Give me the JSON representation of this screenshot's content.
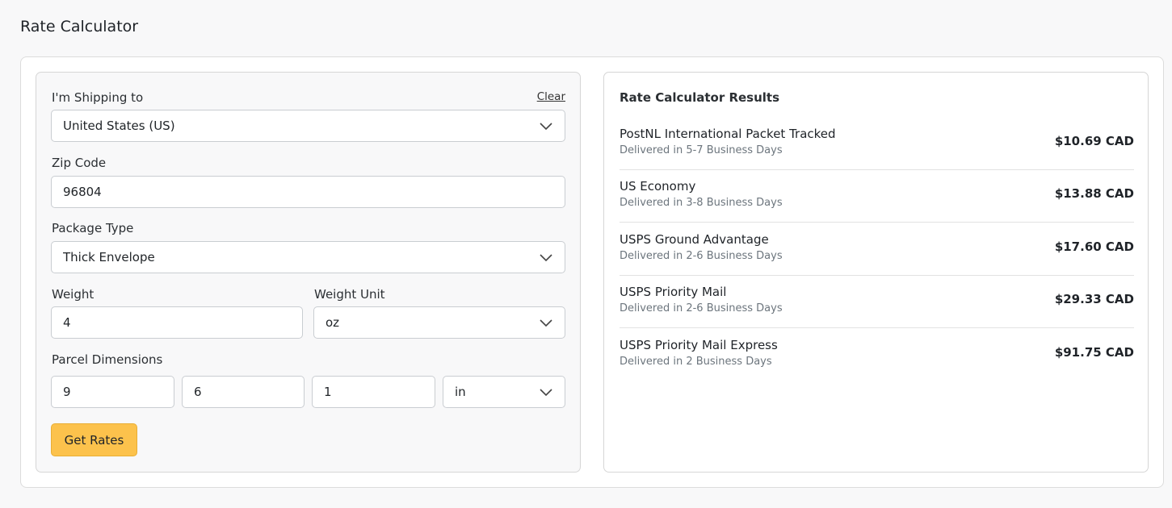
{
  "page": {
    "title": "Rate Calculator"
  },
  "form": {
    "shipping_to": {
      "label": "I'm Shipping to",
      "clear_label": "Clear",
      "value": "United States (US)"
    },
    "zip": {
      "label": "Zip Code",
      "value": "96804"
    },
    "package_type": {
      "label": "Package Type",
      "value": "Thick Envelope"
    },
    "weight": {
      "label": "Weight",
      "value": "4"
    },
    "weight_unit": {
      "label": "Weight Unit",
      "value": "oz"
    },
    "dimensions": {
      "label": "Parcel Dimensions",
      "length": "9",
      "width": "6",
      "height": "1",
      "unit": "in"
    },
    "submit_label": "Get Rates"
  },
  "results": {
    "title": "Rate Calculator Results",
    "rates": [
      {
        "name": "PostNL International Packet Tracked",
        "delivery": "Delivered in 5-7 Business Days",
        "price": "$10.69 CAD"
      },
      {
        "name": "US Economy",
        "delivery": "Delivered in 3-8 Business Days",
        "price": "$13.88 CAD"
      },
      {
        "name": "USPS Ground Advantage",
        "delivery": "Delivered in 2-6 Business Days",
        "price": "$17.60 CAD"
      },
      {
        "name": "USPS Priority Mail",
        "delivery": "Delivered in 2-6 Business Days",
        "price": "$29.33 CAD"
      },
      {
        "name": "USPS Priority Mail Express",
        "delivery": "Delivered in 2 Business Days",
        "price": "$91.75 CAD"
      }
    ]
  },
  "icons": {
    "dropdown": "chevron-down-icon"
  },
  "colors": {
    "accent_button": "#fcc24c"
  }
}
